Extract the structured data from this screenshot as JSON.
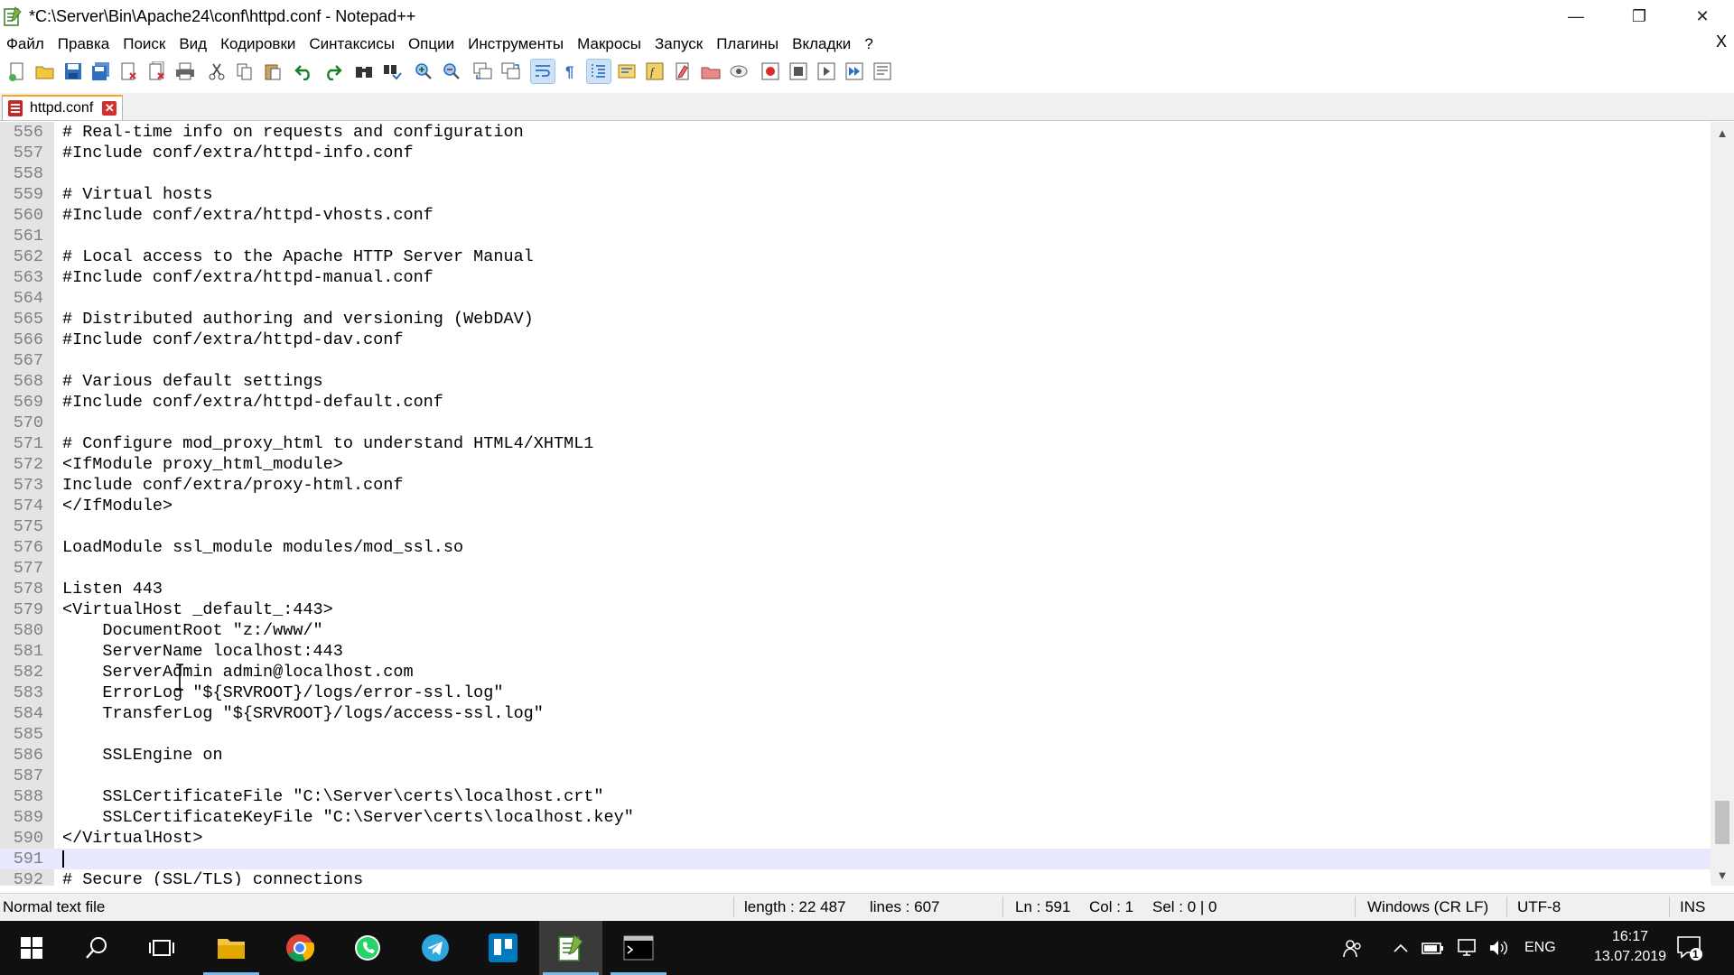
{
  "window": {
    "title": "*C:\\Server\\Bin\\Apache24\\conf\\httpd.conf - Notepad++",
    "minimize_glyph": "—",
    "restore_glyph": "❐",
    "close_glyph": "✕"
  },
  "menu": {
    "items": [
      "Файл",
      "Правка",
      "Поиск",
      "Вид",
      "Кодировки",
      "Синтаксисы",
      "Опции",
      "Инструменты",
      "Макросы",
      "Запуск",
      "Плагины",
      "Вкладки",
      "?"
    ],
    "close_glyph": "X"
  },
  "toolbar": {
    "icons": [
      "new-file-icon",
      "open-file-icon",
      "save-icon",
      "save-all-icon",
      "close-icon",
      "close-all-icon",
      "print-icon",
      "cut-icon",
      "copy-icon",
      "paste-icon",
      "undo-icon",
      "redo-icon",
      "find-icon",
      "replace-icon",
      "zoom-in-icon",
      "zoom-out-icon",
      "sync-vertical-icon",
      "sync-horizontal-icon",
      "word-wrap-icon",
      "show-all-chars-icon",
      "indent-guide-icon",
      "doc-map-icon",
      "function-list-icon",
      "folder-as-workspace-icon",
      "monitoring-icon",
      "record-macro-icon",
      "stop-record-icon",
      "play-macro-icon",
      "run-macro-multiple-icon",
      "save-macro-icon"
    ]
  },
  "tab": {
    "label": "httpd.conf",
    "close_glyph": "✕"
  },
  "editor": {
    "lines": [
      {
        "n": "556",
        "text": "# Real-time info on requests and configuration"
      },
      {
        "n": "557",
        "text": "#Include conf/extra/httpd-info.conf"
      },
      {
        "n": "558",
        "text": ""
      },
      {
        "n": "559",
        "text": "# Virtual hosts"
      },
      {
        "n": "560",
        "text": "#Include conf/extra/httpd-vhosts.conf"
      },
      {
        "n": "561",
        "text": ""
      },
      {
        "n": "562",
        "text": "# Local access to the Apache HTTP Server Manual"
      },
      {
        "n": "563",
        "text": "#Include conf/extra/httpd-manual.conf"
      },
      {
        "n": "564",
        "text": ""
      },
      {
        "n": "565",
        "text": "# Distributed authoring and versioning (WebDAV)"
      },
      {
        "n": "566",
        "text": "#Include conf/extra/httpd-dav.conf"
      },
      {
        "n": "567",
        "text": ""
      },
      {
        "n": "568",
        "text": "# Various default settings"
      },
      {
        "n": "569",
        "text": "#Include conf/extra/httpd-default.conf"
      },
      {
        "n": "570",
        "text": ""
      },
      {
        "n": "571",
        "text": "# Configure mod_proxy_html to understand HTML4/XHTML1"
      },
      {
        "n": "572",
        "text": "<IfModule proxy_html_module>"
      },
      {
        "n": "573",
        "text": "Include conf/extra/proxy-html.conf"
      },
      {
        "n": "574",
        "text": "</IfModule>"
      },
      {
        "n": "575",
        "text": ""
      },
      {
        "n": "576",
        "text": "LoadModule ssl_module modules/mod_ssl.so"
      },
      {
        "n": "577",
        "text": ""
      },
      {
        "n": "578",
        "text": "Listen 443"
      },
      {
        "n": "579",
        "text": "<VirtualHost _default_:443>"
      },
      {
        "n": "580",
        "text": "    DocumentRoot \"z:/www/\""
      },
      {
        "n": "581",
        "text": "    ServerName localhost:443"
      },
      {
        "n": "582",
        "text": "    ServerAdmin admin@localhost.com"
      },
      {
        "n": "583",
        "text": "    ErrorLog \"${SRVROOT}/logs/error-ssl.log\""
      },
      {
        "n": "584",
        "text": "    TransferLog \"${SRVROOT}/logs/access-ssl.log\""
      },
      {
        "n": "585",
        "text": ""
      },
      {
        "n": "586",
        "text": "    SSLEngine on"
      },
      {
        "n": "587",
        "text": ""
      },
      {
        "n": "588",
        "text": "    SSLCertificateFile \"C:\\Server\\certs\\localhost.crt\""
      },
      {
        "n": "589",
        "text": "    SSLCertificateKeyFile \"C:\\Server\\certs\\localhost.key\""
      },
      {
        "n": "590",
        "text": "</VirtualHost>"
      },
      {
        "n": "591",
        "text": "",
        "current": true
      },
      {
        "n": "592",
        "text": "# Secure (SSL/TLS) connections"
      }
    ]
  },
  "status": {
    "file_type": "Normal text file",
    "length": "length : 22 487",
    "lines": "lines : 607",
    "ln": "Ln : 591",
    "col": "Col : 1",
    "sel": "Sel : 0 | 0",
    "eol": "Windows (CR LF)",
    "encoding": "UTF-8",
    "mode": "INS"
  },
  "taskbar": {
    "apps": [
      "start-icon",
      "search-icon",
      "task-view-icon",
      "file-explorer-icon",
      "chrome-icon",
      "whatsapp-icon",
      "telegram-icon",
      "trello-icon",
      "notepadpp-icon",
      "terminal-icon"
    ],
    "language": "ENG",
    "time": "16:17",
    "date": "13.07.2019",
    "notification_count": "1"
  }
}
